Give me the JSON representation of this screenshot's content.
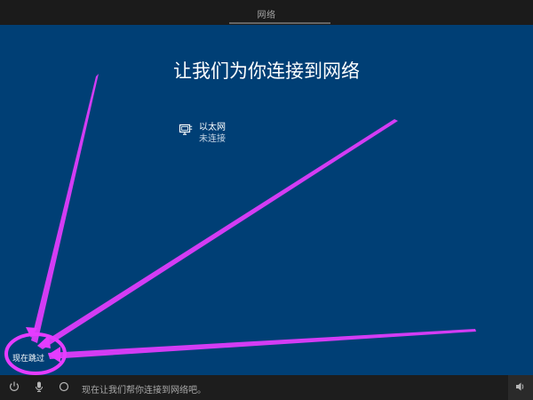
{
  "header": {
    "title": "网络"
  },
  "main": {
    "title": "让我们为你连接到网络",
    "network": {
      "name": "以太网",
      "status": "未连接",
      "icon": "ethernet-icon"
    }
  },
  "actions": {
    "skip_label": "现在跳过"
  },
  "taskbar": {
    "hint_text": "现在让我们帮你连接到网络吧。",
    "icons": [
      "power-icon",
      "microphone-icon",
      "cortana-icon",
      "speaker-icon"
    ]
  },
  "colors": {
    "background": "#003f75",
    "annotation": "#e53cff"
  }
}
